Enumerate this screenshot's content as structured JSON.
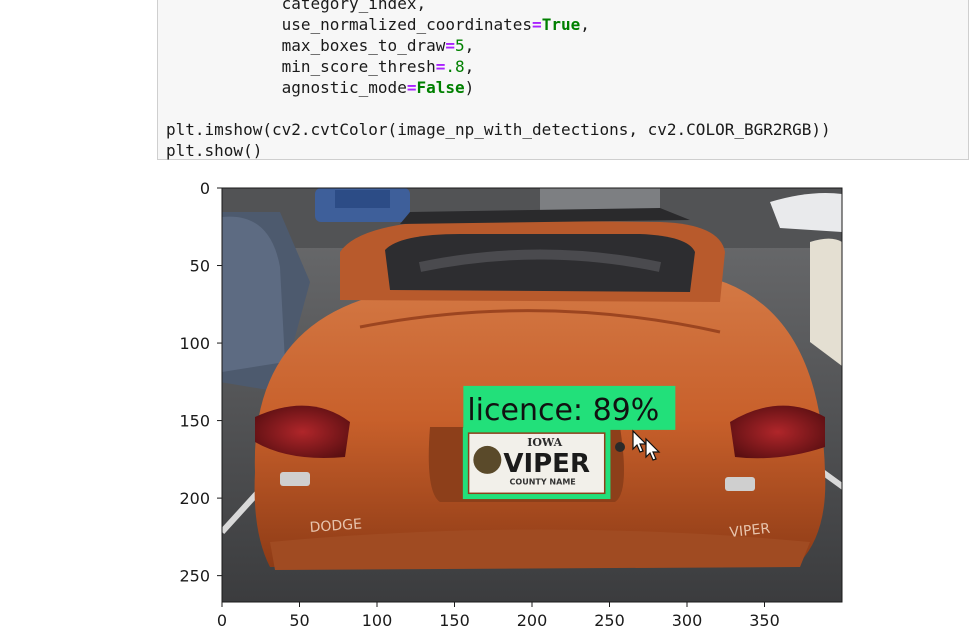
{
  "code_cell": {
    "lines": [
      [
        {
          "t": "            category_index,"
        }
      ],
      [
        {
          "t": "            use_normalized_coordinates"
        },
        {
          "t": "=",
          "c": "op"
        },
        {
          "t": "True",
          "c": "kw"
        },
        {
          "t": ","
        }
      ],
      [
        {
          "t": "            max_boxes_to_draw"
        },
        {
          "t": "=",
          "c": "op"
        },
        {
          "t": "5",
          "c": "num"
        },
        {
          "t": ","
        }
      ],
      [
        {
          "t": "            min_score_thresh"
        },
        {
          "t": "=",
          "c": "op"
        },
        {
          "t": ".8",
          "c": "num"
        },
        {
          "t": ","
        }
      ],
      [
        {
          "t": "            agnostic_mode"
        },
        {
          "t": "=",
          "c": "op"
        },
        {
          "t": "False",
          "c": "kw"
        },
        {
          "t": ")"
        }
      ],
      [
        {
          "t": ""
        }
      ],
      [
        {
          "t": "plt.imshow(cv2.cvtColor(image_np_with_detections, cv2.COLOR_BGR2RGB))"
        }
      ],
      [
        {
          "t": "plt.show()"
        }
      ]
    ]
  },
  "plot": {
    "x_ticks": [
      "0",
      "50",
      "100",
      "150",
      "200",
      "250",
      "300",
      "350"
    ],
    "y_ticks": [
      "0",
      "50",
      "100",
      "150",
      "200",
      "250"
    ],
    "x_tick_values": [
      0,
      50,
      100,
      150,
      200,
      250,
      300,
      350
    ],
    "y_tick_values": [
      0,
      50,
      100,
      150,
      200,
      250
    ],
    "image_extent": {
      "width": 400,
      "height": 267
    },
    "detection": {
      "label": "licence: 89%",
      "box_data": {
        "x0": 157,
        "y0": 156,
        "x1": 249,
        "y1": 199
      },
      "box_color": "#22e07a"
    },
    "plate": {
      "state": "IOWA",
      "name": "VIPER",
      "county": "COUNTY NAME"
    },
    "car_badges": {
      "left": "DODGE",
      "right": "VIPER"
    }
  }
}
